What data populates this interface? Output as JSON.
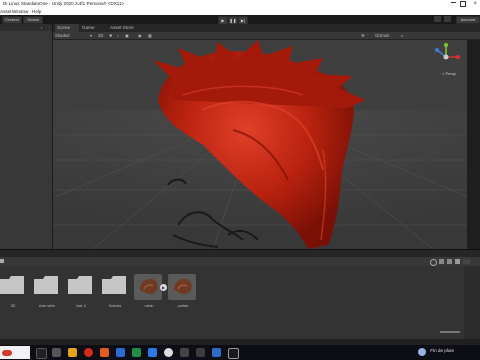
{
  "window": {
    "title": "Di Linux StandaloOne - Unity 2020.3.4f1 Personal* <DX11>",
    "menu": [
      "Asset",
      "Window",
      "Help"
    ]
  },
  "toolbar": {
    "left_buttons": [
      "Context",
      "Global"
    ],
    "play_buttons": [
      "play-icon",
      "pause-icon",
      "step-icon"
    ],
    "right_label": "Account"
  },
  "scene": {
    "tabs": [
      "Scene",
      "Game",
      "Asset Store"
    ],
    "shading_mode": "Shaded",
    "mode_2d": "2D",
    "gizmos_label": "Gizmos",
    "persp_label": "< Persp"
  },
  "project": {
    "assets": [
      {
        "label": "3D",
        "kind": "folder"
      },
      {
        "label": "char sirim",
        "kind": "folder"
      },
      {
        "label": "hair 4",
        "kind": "folder"
      },
      {
        "label": "Scenes",
        "kind": "folder"
      },
      {
        "label": "cabin",
        "kind": "prefab"
      },
      {
        "label": "prefab",
        "kind": "prefab"
      }
    ]
  },
  "taskbar": {
    "weather_text": "Fin de pluie"
  },
  "colors": {
    "hair_dark": "#8a1208",
    "hair_mid": "#b8220f",
    "hair_light": "#e0402a",
    "viewport_bg": "#3d3d3d",
    "gizmo_x": "#d33333",
    "gizmo_y": "#7cc832",
    "gizmo_z": "#3a7bd5"
  }
}
